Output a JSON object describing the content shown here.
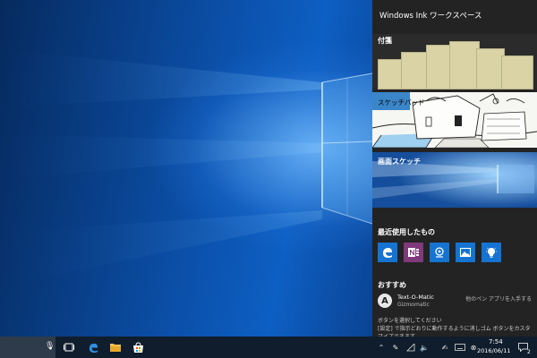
{
  "ink_workspace": {
    "title": "Windows Ink ワークスペース",
    "sticky_notes_label": "付箋",
    "sketchpad_label": "スケッチパッド",
    "screen_sketch_label": "画面スケッチ",
    "recent_label": "最近使用したもの",
    "recent_apps": [
      {
        "icon": "edge-icon",
        "color": "#1573d1"
      },
      {
        "icon": "onenote-icon",
        "color": "#80397b"
      },
      {
        "icon": "maps-icon",
        "color": "#1573d1"
      },
      {
        "icon": "photos-icon",
        "color": "#1573d1"
      },
      {
        "icon": "tips-icon",
        "color": "#1573d1"
      }
    ],
    "suggested_label": "おすすめ",
    "suggested_app": {
      "name": "Text-O-Matic",
      "publisher": "Gizmomatic",
      "more_link": "他のペン アプリを入手する"
    },
    "help_line1": "ボタンを選択してください",
    "help_line2": "[設定] で指示どおりに動作するように消しゴム ボタンをカスタマイズできます",
    "help_line3": "す"
  },
  "taskbar": {
    "time": "7:54",
    "date": "2016/06/11",
    "notification_count": "2",
    "colors": {
      "background": "#101d2c",
      "search": "#2d3b4a"
    }
  },
  "colors": {
    "panel": "#232323",
    "accent": "#1573d1"
  }
}
